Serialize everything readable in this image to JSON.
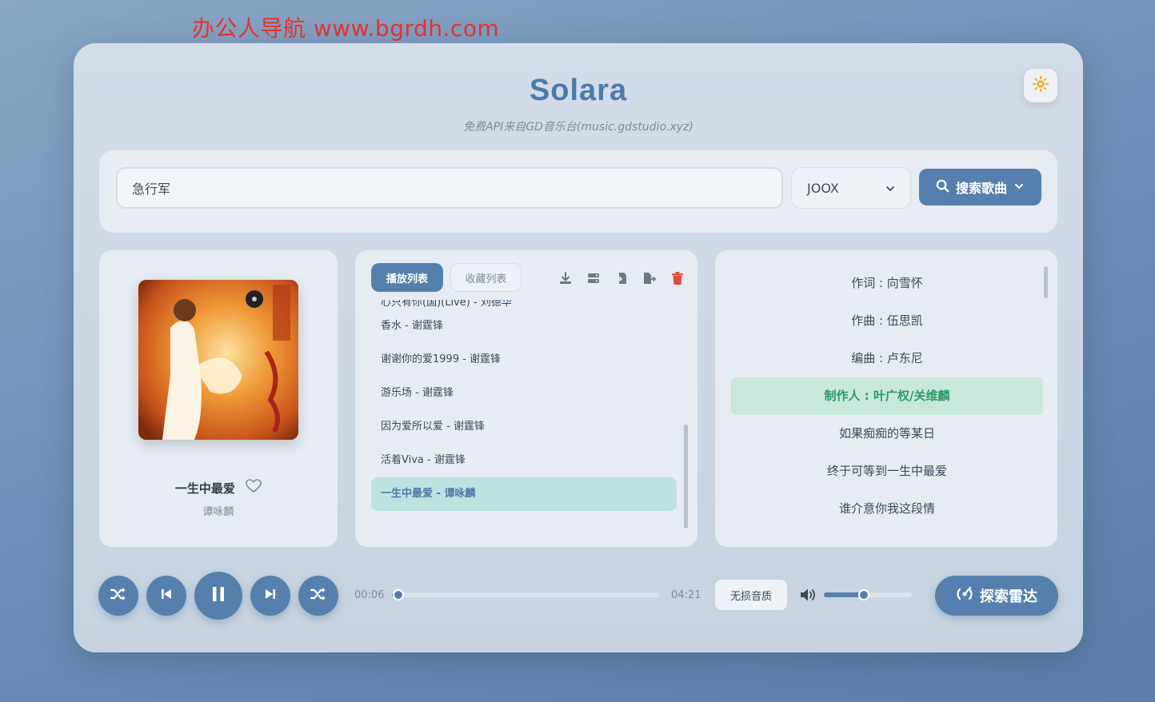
{
  "watermark": "办公人导航 www.bgrdh.com",
  "header": {
    "title": "Solara",
    "subtitle": "免费API来自GD音乐台(music.gdstudio.xyz)",
    "theme_icon": "sun-icon"
  },
  "search": {
    "query": "急行军",
    "source": "JOOX",
    "button_label": "搜索歌曲"
  },
  "now_playing": {
    "title": "一生中最爱",
    "artist": "谭咏麟"
  },
  "playlist": {
    "tabs": [
      {
        "label": "播放列表",
        "active": true
      },
      {
        "label": "收藏列表",
        "active": false
      }
    ],
    "tools": [
      "download-icon",
      "server-icon",
      "import-icon",
      "export-icon",
      "trash-icon"
    ],
    "items": [
      {
        "label": "心只有你(国)(Live) - 刘德华",
        "partial": true
      },
      {
        "label": "香水 - 谢霆锋"
      },
      {
        "label": "谢谢你的爱1999 - 谢霆锋"
      },
      {
        "label": "游乐场 - 谢霆锋"
      },
      {
        "label": "因为爱所以爱 - 谢霆锋"
      },
      {
        "label": "活着Viva - 谢霆锋"
      },
      {
        "label": "一生中最爱 - 谭咏麟",
        "current": true
      }
    ]
  },
  "lyrics": [
    {
      "text": "作词 : 向雪怀"
    },
    {
      "text": "作曲 : 伍思凯"
    },
    {
      "text": "编曲 : 卢东尼"
    },
    {
      "text": "制作人 : 叶广权/关维麟",
      "active": true
    },
    {
      "text": "如果痴痴的等某日"
    },
    {
      "text": "终于可等到一生中最爱"
    },
    {
      "text": "谁介意你我这段情"
    }
  ],
  "player": {
    "current_time": "00:06",
    "duration": "04:21",
    "progress": 0.023,
    "quality": "无损音质",
    "volume": 0.45,
    "radar_label": "探索雷达"
  },
  "colors": {
    "accent": "#5580ad",
    "active_lyric": "#2a9a6a",
    "current_track_bg": "#bde2e0",
    "watermark": "#e8322f"
  }
}
